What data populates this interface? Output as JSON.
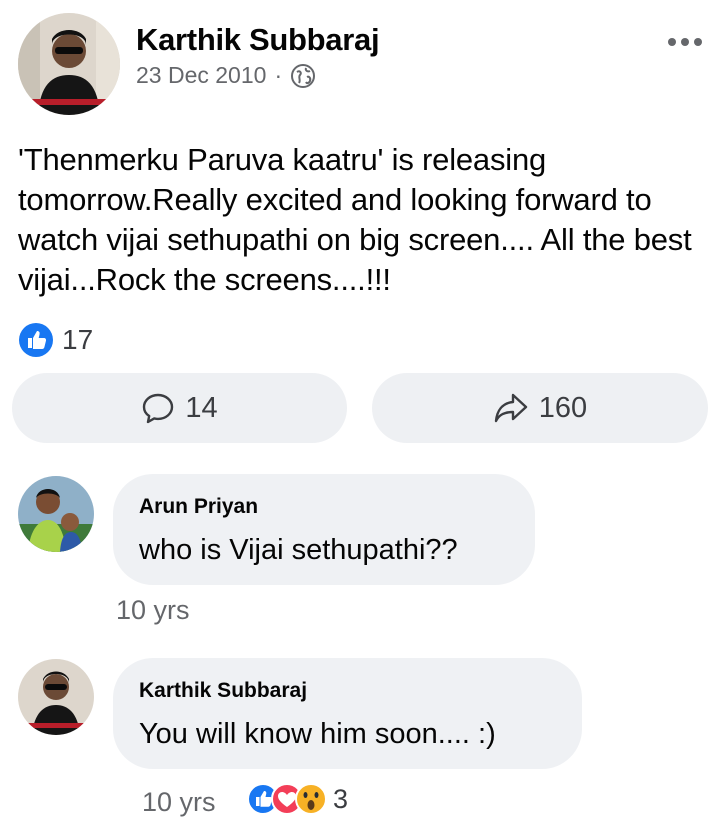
{
  "post": {
    "author": "Karthik Subbaraj",
    "date": "23 Dec 2010",
    "separator": "·",
    "privacy_icon": "globe-icon",
    "menu_icon": "more-dots-icon",
    "text": "'Thenmerku Paruva kaatru' is releasing tomorrow.Really excited and looking forward to watch vijai sethupathi on big screen.... All the best vijai...Rock the screens....!!!",
    "like_count": "17",
    "comment_count": "14",
    "share_count": "160"
  },
  "comments": [
    {
      "author": "Arun Priyan",
      "text": "who is Vijai sethupathi??",
      "time": "10 yrs"
    },
    {
      "author": "Karthik Subbaraj",
      "text": "You will know him soon.... :)",
      "time": "10 yrs",
      "reaction_count": "3"
    }
  ],
  "colors": {
    "like_blue": "#1877f2",
    "love_red": "#f33e58",
    "wow_yellow": "#f7b125",
    "secondary_text": "#65676b",
    "bubble_bg": "#eff1f4"
  }
}
